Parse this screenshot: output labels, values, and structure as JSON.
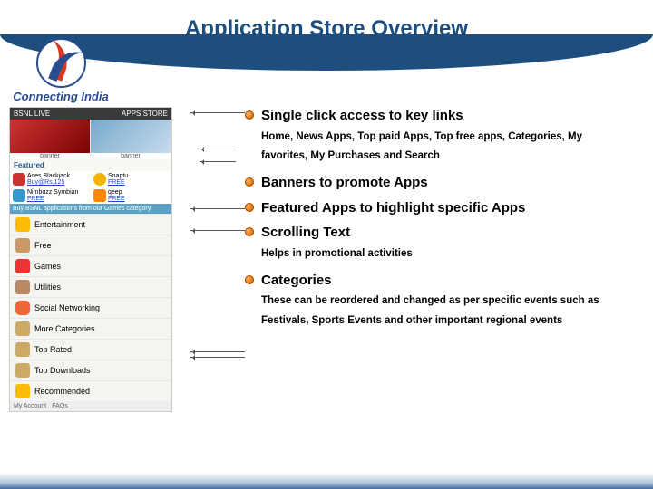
{
  "title": "Application Store Overview",
  "logo_text": "Connecting India",
  "mock": {
    "topbar_left": "BSNL LIVE",
    "topbar_right": "APPS STORE",
    "banner_label": "banner",
    "section_featured": "Featured",
    "app1": "Aces Blackjack",
    "app1b": "Buy@Rs.125",
    "app2": "Snaptu",
    "app2b": "FREE",
    "app3": "Nimbuzz Symbian",
    "app3b": "FREE",
    "app4": "qeep",
    "app4b": "FREE",
    "scroll": "Buy BSNL applications from our Games category",
    "cats": [
      "Entertainment",
      "Free",
      "Games",
      "Utilities",
      "Social Networking",
      "More Categories",
      "Top Rated",
      "Top Downloads",
      "Recommended"
    ],
    "bottom_a": "My Account",
    "bottom_b": "FAQs"
  },
  "bullets": [
    {
      "head": "Single click access to key links",
      "sub": "Home, News Apps, Top paid Apps, Top free apps, Categories, My favorites, My Purchases and Search"
    },
    {
      "head": "Banners to promote Apps",
      "sub": ""
    },
    {
      "head": "Featured Apps to highlight specific Apps",
      "sub": ""
    },
    {
      "head": "Scrolling Text",
      "sub": "Helps in promotional activities"
    },
    {
      "head": "Categories",
      "sub": "These can be reordered and changed as per specific events such as Festivals, Sports Events and other important regional events"
    }
  ]
}
